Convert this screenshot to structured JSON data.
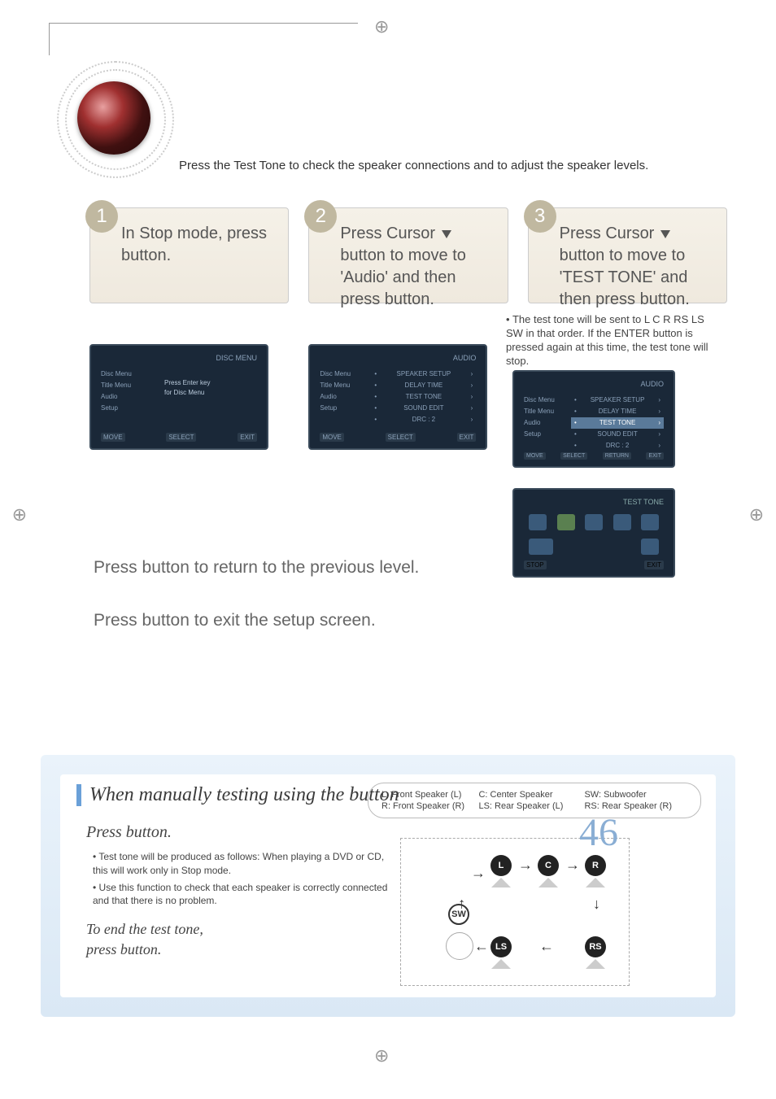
{
  "intro": "Press the Test Tone to check the speaker connections and to adjust the speaker levels.",
  "steps": {
    "s1": {
      "num": "1",
      "pre": "In Stop mode, press ",
      "label": "",
      "post": " button."
    },
    "s2": {
      "num": "2",
      "l1": "Press Cursor ",
      "l2": " button to move to 'Audio' and then press ",
      "label": "",
      "post": " button."
    },
    "s3": {
      "num": "3",
      "l1": "Press Cursor ",
      "l2": " button to move to 'TEST TONE' and then press ",
      "label": "",
      "post": " button."
    }
  },
  "note3": {
    "bullet": "•",
    "line1": "The test tone will be sent to L     C     R     RS     LS     SW in that order. If the ENTER button is pressed again at this time, the test tone will stop."
  },
  "tv1": {
    "title": "",
    "corner": "DISC MENU",
    "side": [
      "Disc Menu",
      "Title Menu",
      "Audio",
      "Setup"
    ],
    "center1": "Press Enter key",
    "center2": "for Disc Menu",
    "bottom": [
      "MOVE",
      "SELECT",
      "EXIT"
    ]
  },
  "tv2": {
    "title": "",
    "corner": "AUDIO",
    "side": [
      "Disc Menu",
      "Title Menu",
      "Audio",
      "Setup"
    ],
    "menu": [
      "SPEAKER SETUP",
      "DELAY TIME",
      "TEST TONE",
      "SOUND EDIT",
      "DRC      : 2"
    ],
    "bottom": [
      "MOVE",
      "SELECT",
      "EXIT"
    ]
  },
  "tv3a": {
    "corner": "AUDIO",
    "side": [
      "Disc Menu",
      "Title Menu",
      "Audio",
      "Setup"
    ],
    "menu": [
      "SPEAKER SETUP",
      "DELAY TIME",
      "TEST TONE",
      "SOUND EDIT",
      "DRC      : 2"
    ],
    "hl": 2,
    "bottom": [
      "MOVE",
      "SELECT",
      "RETURN",
      "EXIT"
    ]
  },
  "tv3b": {
    "corner": "TEST TONE",
    "bottom": [
      "STOP",
      "EXIT"
    ]
  },
  "lower": {
    "l1a": "Press ",
    "l1b": " button to return to the previous level.",
    "l2a": "Press ",
    "l2b": " button to exit the setup screen."
  },
  "blue": {
    "title_a": "When manually testing using the ",
    "title_b": " button",
    "sub_a": "Press ",
    "sub_b": " button.",
    "bullets": [
      "Test tone will be produced as follows: When playing a DVD or CD, this will work only in Stop mode.",
      "Use this function to check that each speaker is correctly connected and that there is no problem."
    ],
    "end_a": "To end the test tone,",
    "end_b": "press ",
    "end_c": " button.",
    "legend": {
      "L": "L: Front Speaker (L)",
      "C": "C: Center Speaker",
      "SW": "SW: Subwoofer",
      "R": "R: Front Speaker (R)",
      "LS": "LS: Rear Speaker (L)",
      "RS": "RS: Rear Speaker (R)"
    },
    "nodes": {
      "L": "L",
      "C": "C",
      "R": "R",
      "SW": "SW",
      "LS": "LS",
      "RS": "RS"
    }
  },
  "pagenum": "46"
}
